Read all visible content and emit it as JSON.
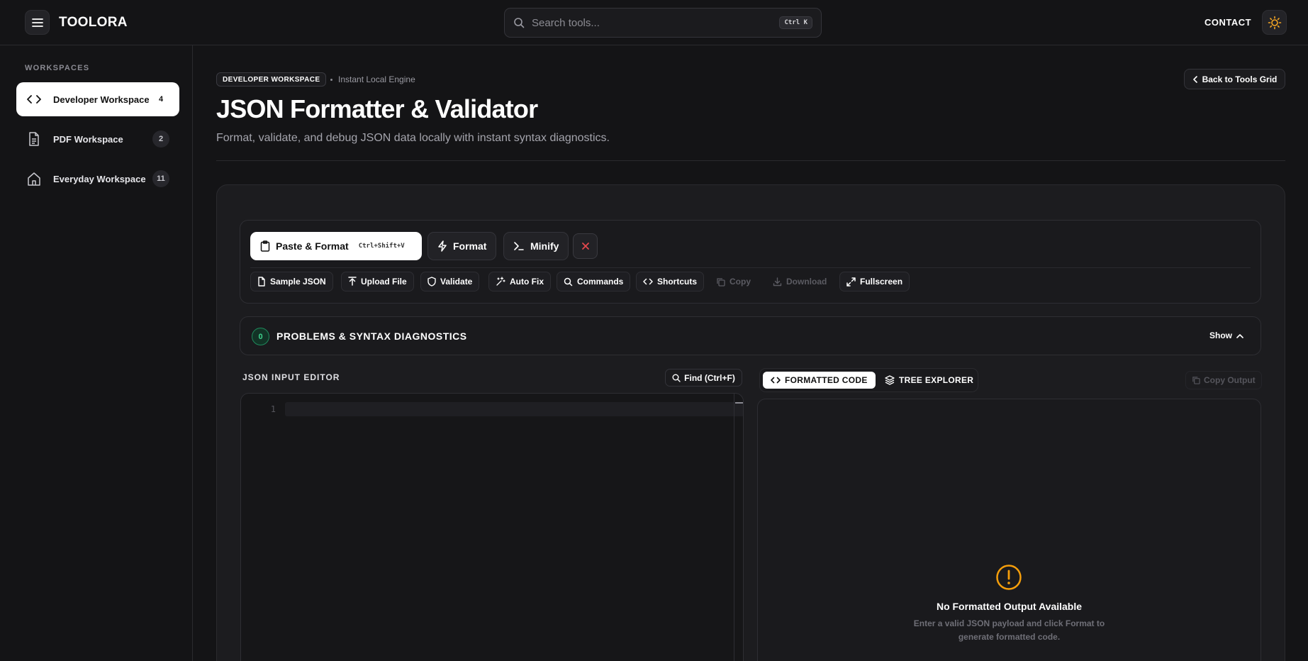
{
  "app": {
    "brand": "TOOLORA",
    "search_placeholder": "Search tools...",
    "search_shortcut": "Ctrl K",
    "contact_label": "CONTACT"
  },
  "sidebar": {
    "title": "WORKSPACES",
    "items": [
      {
        "label": "Developer Workspace",
        "count": "4",
        "icon": "code-icon",
        "active": true
      },
      {
        "label": "PDF Workspace",
        "count": "2",
        "icon": "document-icon",
        "active": false
      },
      {
        "label": "Everyday Workspace",
        "count": "11",
        "icon": "home-icon",
        "active": false
      }
    ]
  },
  "page": {
    "badge": "DEVELOPER WORKSPACE",
    "engine": "Instant Local Engine",
    "back_label": "Back to Tools Grid",
    "title": "JSON Formatter & Validator",
    "subtitle": "Format, validate, and debug JSON data locally with instant syntax diagnostics."
  },
  "toolbar": {
    "paste_label": "Paste & Format",
    "paste_shortcut": "Ctrl+Shift+V",
    "format_label": "Format",
    "minify_label": "Minify",
    "actions": [
      {
        "label": "Sample JSON",
        "icon": "file-icon",
        "enabled": true
      },
      {
        "label": "Upload File",
        "icon": "upload-icon",
        "enabled": true
      },
      {
        "label": "Validate",
        "icon": "shield-icon",
        "enabled": true
      },
      {
        "label": "Auto Fix",
        "icon": "sparkles-icon",
        "enabled": true
      },
      {
        "label": "Commands",
        "icon": "search-icon",
        "enabled": true
      },
      {
        "label": "Shortcuts",
        "icon": "code-icon",
        "enabled": true
      },
      {
        "label": "Copy",
        "icon": "copy-icon",
        "enabled": false
      },
      {
        "label": "Download",
        "icon": "download-icon",
        "enabled": false
      },
      {
        "label": "Fullscreen",
        "icon": "expand-icon",
        "enabled": true
      }
    ]
  },
  "problems": {
    "count": "0",
    "title": "PROBLEMS & SYNTAX DIAGNOSTICS",
    "toggle_label": "Show"
  },
  "editor": {
    "label": "JSON INPUT EDITOR",
    "find_label": "Find (Ctrl+F)",
    "line_number": "1"
  },
  "output": {
    "tabs": [
      {
        "label": "FORMATTED CODE",
        "active": true
      },
      {
        "label": "TREE EXPLORER",
        "active": false
      }
    ],
    "copy_label": "Copy Output",
    "empty_title": "No Formatted Output Available",
    "empty_desc": "Enter a valid JSON payload and click Format to generate formatted code."
  },
  "colors": {
    "background": "#141416",
    "card": "#1c1c1f",
    "accent_error": "#e5484d",
    "accent_warning": "#f59e0b",
    "accent_success": "#3fd08c"
  }
}
